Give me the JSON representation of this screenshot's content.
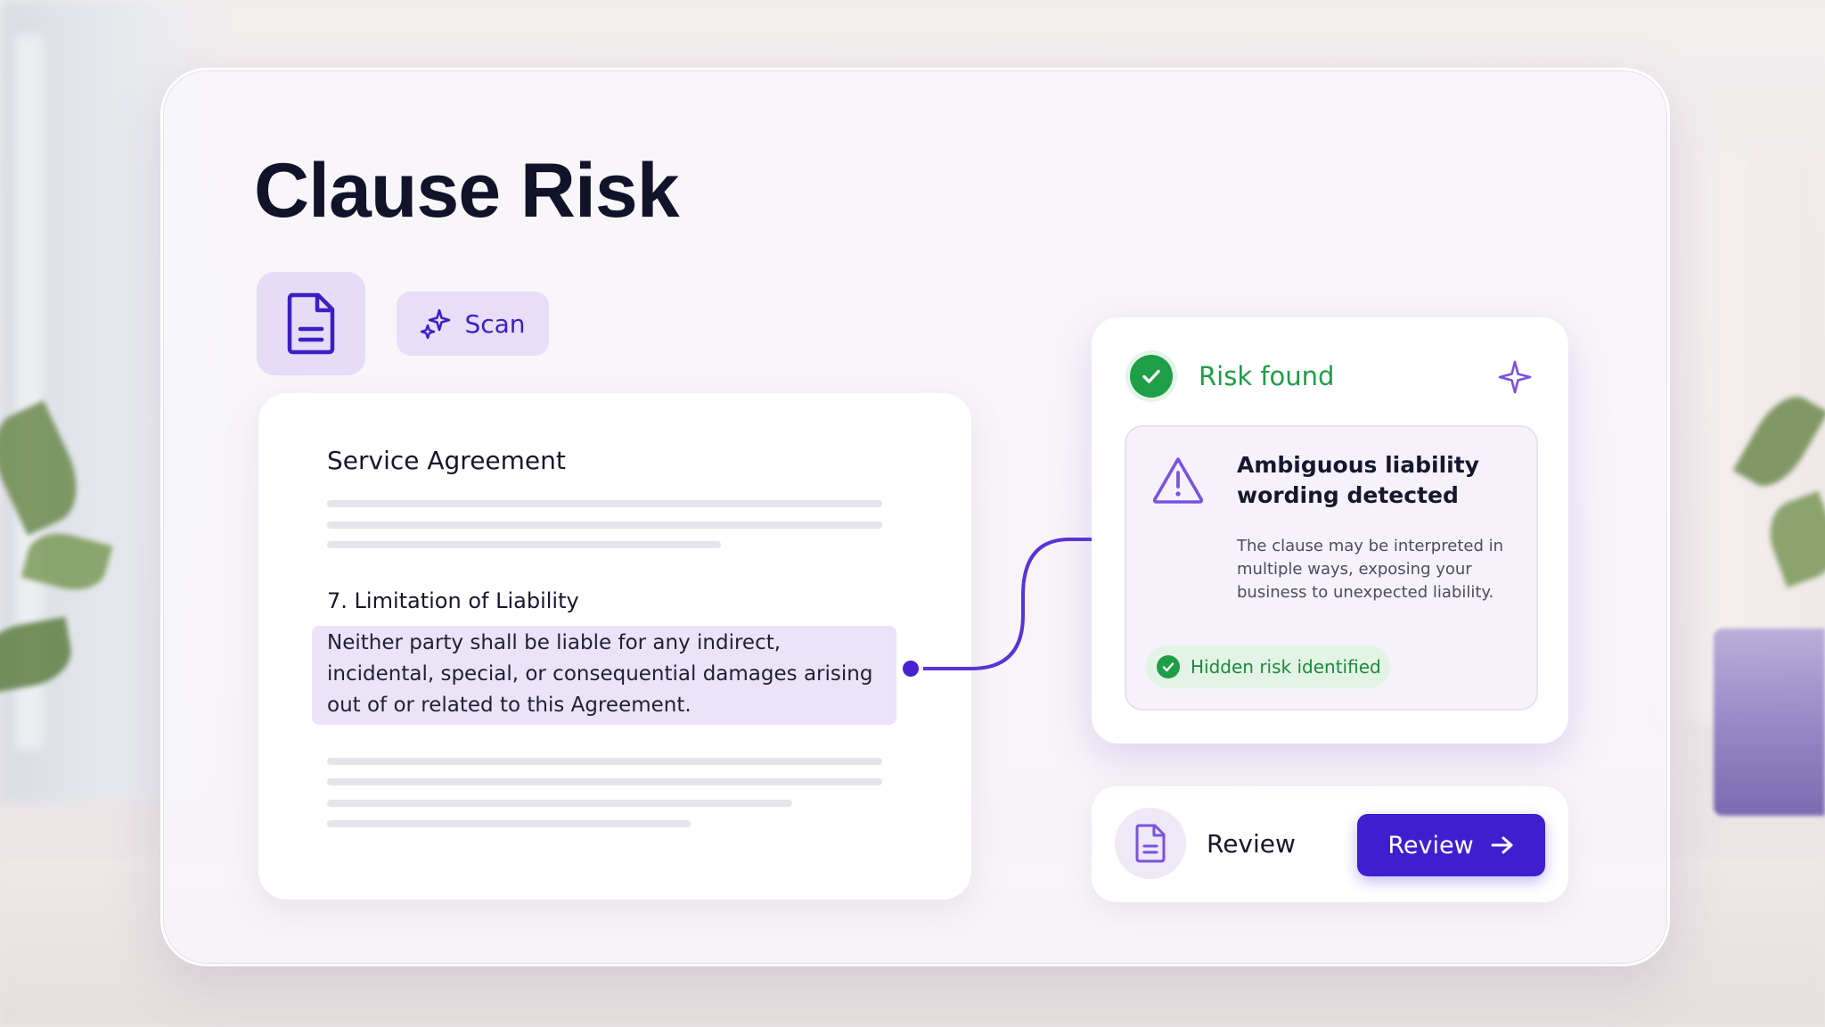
{
  "app": {
    "title": "Clause Risk",
    "scan_label": "Scan"
  },
  "document": {
    "title": "Service Agreement",
    "section_heading": "7. Limitation of Liability",
    "clause_text": "Neither party shall be liable for any indirect, incidental, special, or consequential damages arising out of or related to this Agreement."
  },
  "risk": {
    "status": "Risk found",
    "heading": "Ambiguous liability wording detected",
    "description": "The clause may be interpreted in multiple ways, exposing your business to unexpected liability.",
    "badge": "Hidden risk identified"
  },
  "review": {
    "label": "Review",
    "button_label": "Review"
  },
  "icons": {
    "doc_tile": "document-icon",
    "scan": "sparkles-icon",
    "risk_status": "check-circle-icon",
    "risk_corner": "sparkle-icon",
    "warning": "warning-triangle-icon",
    "badge": "check-circle-icon",
    "review": "document-icon",
    "review_button": "arrow-right-icon"
  },
  "colors": {
    "accent": "#3e1fd0",
    "success": "#1e9e46",
    "title": "#12132a",
    "highlight": "#ebe3fa"
  }
}
